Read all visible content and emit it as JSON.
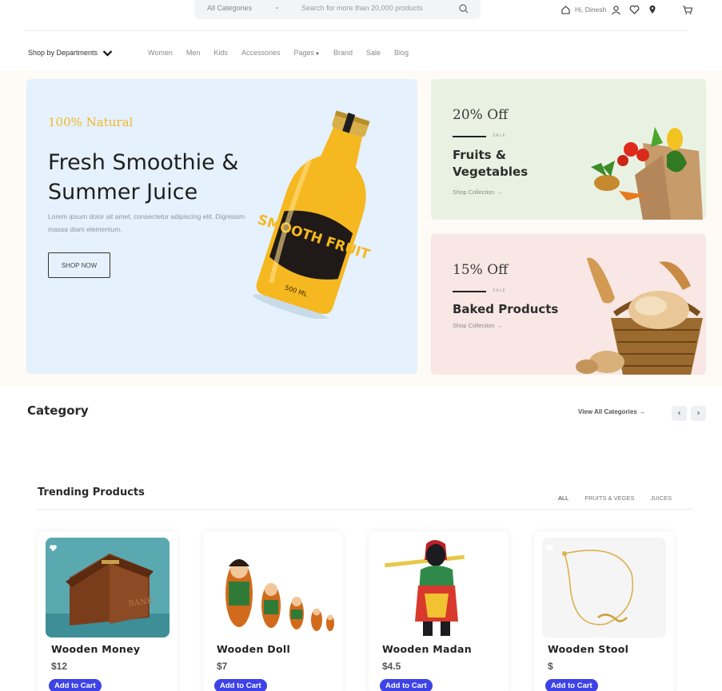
{
  "search": {
    "category": "All Categories",
    "placeholder": "Search for more than 20,000 products"
  },
  "header": {
    "greeting": "Hi, Dinesh"
  },
  "nav": {
    "departments_label": "Shop by Departments",
    "items": [
      "Women",
      "Men",
      "Kids",
      "Accessories",
      "Pages",
      "Brand",
      "Sale",
      "Blog"
    ]
  },
  "hero": {
    "tag": "100% Natural",
    "title": "Fresh Smoothie & Summer Juice",
    "description": "Lorem ipsum dolor sit amet, consectetur adipiscing elit. Dignissim massa diam elementum.",
    "button": "SHOP NOW",
    "bottle_text": "SMOOTH FRUIT",
    "bottle_volume": "500 ML"
  },
  "promos": [
    {
      "discount": "20% Off",
      "sale": "SALE",
      "title": "Fruits & Vegetables",
      "link": "Shop Collection →"
    },
    {
      "discount": "15% Off",
      "sale": "SALE",
      "title": "Baked Products",
      "link": "Shop Collection →"
    }
  ],
  "category": {
    "heading": "Category",
    "view_all": "View All Categories →"
  },
  "trending": {
    "heading": "Trending Products",
    "tabs": [
      "ALL",
      "FRUITS & VEGES",
      "JUICES"
    ],
    "products": [
      {
        "name": "Wooden Money",
        "price": "$12",
        "cta": "Add to Cart"
      },
      {
        "name": "Wooden Doll",
        "price": "$7",
        "cta": "Add to Cart"
      },
      {
        "name": "Wooden Madan",
        "price": "$4.5",
        "cta": "Add to Cart"
      },
      {
        "name": "Wooden Stool",
        "price": "$",
        "cta": "Add to Cart"
      }
    ]
  },
  "colors": {
    "accent": "#f3b72a",
    "cta": "#3d43e8",
    "hero_bg": "#e5f1fc",
    "promo_green": "#e9f2e2",
    "promo_pink": "#f8e7e4"
  }
}
